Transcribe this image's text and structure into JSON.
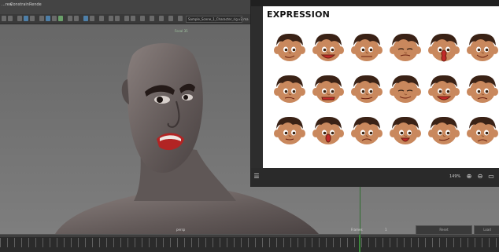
{
  "menubar": {
    "items": [
      "...rew",
      "Constrain",
      "Rende"
    ]
  },
  "shelf": {
    "field_text": "Sample_Scene_1_Character_rig.v2.ma"
  },
  "viewport": {
    "hud_top": "Focal 35",
    "camera_label": "persp",
    "frame_label": "Frames",
    "frame_value": "1"
  },
  "timeline": {
    "right_buttons": [
      "Reset",
      "Load"
    ]
  },
  "viewer": {
    "title": "EXPRESSION",
    "zoom": "149%"
  },
  "faces": [
    {
      "expr": "smirk"
    },
    {
      "expr": "grin"
    },
    {
      "expr": "stern"
    },
    {
      "expr": "squint"
    },
    {
      "expr": "surprised"
    },
    {
      "expr": "smile"
    },
    {
      "expr": "annoyed"
    },
    {
      "expr": "grimace"
    },
    {
      "expr": "determined"
    },
    {
      "expr": "eyes-closed"
    },
    {
      "expr": "toothy"
    },
    {
      "expr": "worried"
    },
    {
      "expr": "wide-eyed"
    },
    {
      "expr": "shocked"
    },
    {
      "expr": "frown"
    },
    {
      "expr": "open-mouth"
    },
    {
      "expr": "smug"
    },
    {
      "expr": "sad"
    }
  ],
  "colors": {
    "skin": "#c9885d",
    "hair": "#3a2216",
    "mouth": "#c22a2a",
    "character_skin": "#6e6462",
    "viewport_bg": "#707070",
    "accent_green": "#3a8a3a"
  }
}
